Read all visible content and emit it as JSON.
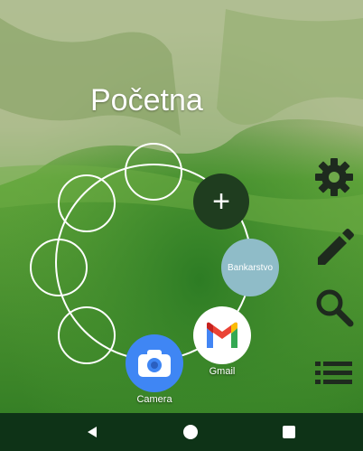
{
  "screen": {
    "title": "Početna"
  },
  "apps": {
    "add_label": "+",
    "bank_label": "Bankarstvo",
    "gmail_label": "Gmail",
    "camera_label": "Camera"
  },
  "side_icons": [
    "gear-icon",
    "pencil-icon",
    "search-icon",
    "list-icon"
  ],
  "nav": {
    "icons": [
      "back-icon",
      "home-icon",
      "recents-icon"
    ]
  },
  "colors": {
    "nav_bar": "#0e3317",
    "bank_circle": "#8fbcc8",
    "add_circle": "#1f3d1f",
    "camera_blue": "#3f86f4"
  }
}
